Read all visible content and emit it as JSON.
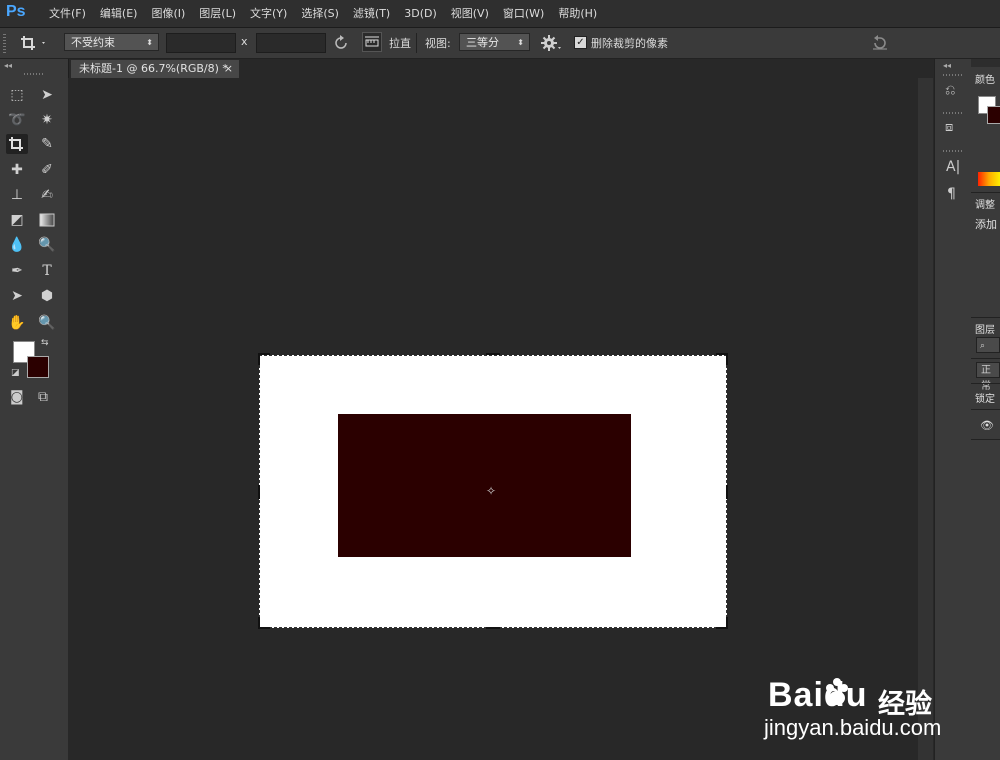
{
  "app": {
    "logo": "Ps",
    "menu": [
      "文件(F)",
      "编辑(E)",
      "图像(I)",
      "图层(L)",
      "文字(Y)",
      "选择(S)",
      "滤镜(T)",
      "3D(D)",
      "视图(V)",
      "窗口(W)",
      "帮助(H)"
    ]
  },
  "options": {
    "ratio_select": "不受约束",
    "width_value": "",
    "x_label": "x",
    "height_value": "",
    "straighten_label": "拉直",
    "view_label": "视图:",
    "view_select": "三等分",
    "delete_cropped_label": "删除裁剪的像素",
    "delete_cropped_checked": true
  },
  "document": {
    "tab_title": "未标题-1 @ 66.7%(RGB/8) *",
    "close_glyph": "×",
    "canvas_color": "#ffffff",
    "rect_color": "#2b0000"
  },
  "colors": {
    "foreground": "#ffffff",
    "background": "#2b0000"
  },
  "panels": {
    "color_tab": "颜色",
    "adjust_tab": "调整",
    "adjust_add": "添加",
    "layers_tab": "图层",
    "layers_search": "",
    "blend_mode": "正常",
    "lock_label": "锁定"
  },
  "watermark": {
    "brand": "Bai",
    "brand2": "du",
    "cn": "经验",
    "url": "jingyan.baidu.com"
  }
}
